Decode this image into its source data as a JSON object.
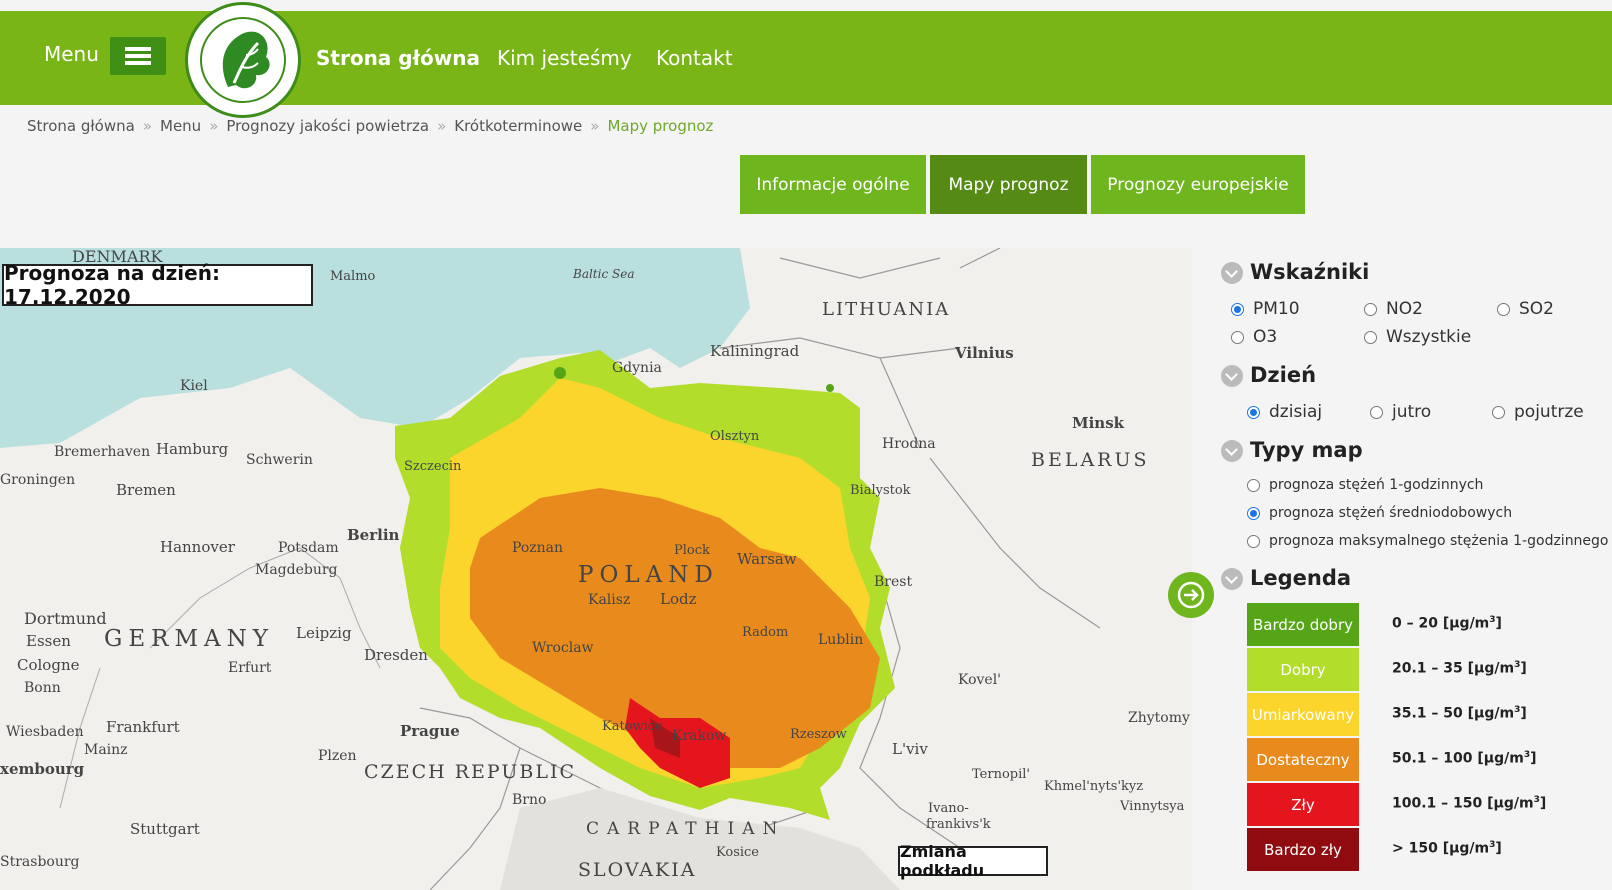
{
  "header": {
    "menu_label": "Menu",
    "nav": [
      "Strona główna",
      "Kim jesteśmy",
      "Kontakt"
    ]
  },
  "breadcrumb": [
    "Strona główna",
    "Menu",
    "Prognozy jakości powietrza",
    "Krótkoterminowe",
    "Mapy prognoz"
  ],
  "tabs": [
    "Informacje ogólne",
    "Mapy prognoz",
    "Prognozy europejskie"
  ],
  "map": {
    "forecast_label": "Prognoza na dzień: 17.12.2020",
    "change_base_label": "Zmiana podkładu",
    "labels": {
      "denmark": "DENMARK",
      "malmo": "Malmo",
      "baltic": "Baltic Sea",
      "lithuania": "LITHUANIA",
      "kaliningrad": "Kaliningrad",
      "vilnius": "Vilnius",
      "kiel": "Kiel",
      "minsk": "Minsk",
      "gdynia": "Gdynia",
      "hrodna": "Hrodna",
      "belarus": "BELARUS",
      "bremerhaven": "Bremerhaven",
      "hamburg": "Hamburg",
      "schwerin": "Schwerin",
      "groningen": "Groningen",
      "bremen": "Bremen",
      "berlin": "Berlin",
      "hannover": "Hannover",
      "potsdam": "Potsdam",
      "magdeburg": "Magdeburg",
      "poland": "POLAND",
      "warsaw": "Warsaw",
      "poznan": "Poznan",
      "brest": "Brest",
      "dortmund": "Dortmund",
      "essen": "Essen",
      "germany": "GERMANY",
      "leipzig": "Leipzig",
      "cologne": "Cologne",
      "erfurt": "Erfurt",
      "bonn": "Bonn",
      "dresden": "Dresden",
      "kalisz": "Kalisz",
      "lodz": "Lodz",
      "lublin": "Lublin",
      "kovel": "Kovel'",
      "wiesbaden": "Wiesbaden",
      "frankfurt": "Frankfurt",
      "mainz": "Mainz",
      "prague": "Prague",
      "zhytomy": "Zhytomy",
      "lviv": "L'viv",
      "plzen": "Plzen",
      "czech": "CZECH REPUBLIC",
      "ternopil": "Ternopil'",
      "khmel": "Khmel'nyts'kyz",
      "luxembourg": "xembourg",
      "brno": "Brno",
      "ivano": "Ivano-",
      "ivano2": "frankivs'k",
      "vinnytsya": "Vinnytsya",
      "stuttgart": "Stuttgart",
      "carpathian": "CARPATHIAN",
      "slovakia": "SLOVAKIA",
      "kosice": "Kosice",
      "strasbourg": "Strasbourg",
      "szczecin": "Szczecin",
      "olsztyn": "Olsztyn",
      "krakow": "Krakow",
      "wroclaw": "Wroclaw",
      "katowice": "Katowice",
      "radom": "Radom",
      "bialystok": "Bialystok",
      "rzeszow": "Rzeszow",
      "plock": "Plock"
    }
  },
  "panel": {
    "indicators_title": "Wskaźniki",
    "indicators": [
      {
        "label": "PM10",
        "selected": true
      },
      {
        "label": "NO2",
        "selected": false
      },
      {
        "label": "SO2",
        "selected": false
      },
      {
        "label": "O3",
        "selected": false
      },
      {
        "label": "Wszystkie",
        "selected": false
      }
    ],
    "day_title": "Dzień",
    "days": [
      {
        "label": "dzisiaj",
        "selected": true
      },
      {
        "label": "jutro",
        "selected": false
      },
      {
        "label": "pojutrze",
        "selected": false
      }
    ],
    "map_types_title": "Typy map",
    "map_types": [
      {
        "label": "prognoza stężeń 1-godzinnych",
        "selected": false
      },
      {
        "label": "prognoza stężeń średniodobowych",
        "selected": true
      },
      {
        "label": "prognoza maksymalnego stężenia 1-godzinnego",
        "selected": false
      }
    ],
    "legend_title": "Legenda",
    "legend": [
      {
        "label": "Bardzo dobry",
        "range": "0 – 20 [µg/m",
        "color": "#55a517"
      },
      {
        "label": "Dobry",
        "range": "20.1 – 35 [µg/m",
        "color": "#b2dd2a"
      },
      {
        "label": "Umiarkowany",
        "range": "35.1 – 50 [µg/m",
        "color": "#fcd52c"
      },
      {
        "label": "Dostateczny",
        "range": "50.1 – 100 [µg/m",
        "color": "#e88b1c"
      },
      {
        "label": "Zły",
        "range": "100.1 – 150 [µg/m",
        "color": "#e5151e"
      },
      {
        "label": "Bardzo zły",
        "range": "> 150 [µg/m",
        "color": "#8f0b10"
      }
    ],
    "unit_sup": "3",
    "unit_close": "]"
  },
  "colors": {
    "brand_green": "#7ab517",
    "tab_active": "#558b14",
    "sea": "#b9e0df"
  }
}
